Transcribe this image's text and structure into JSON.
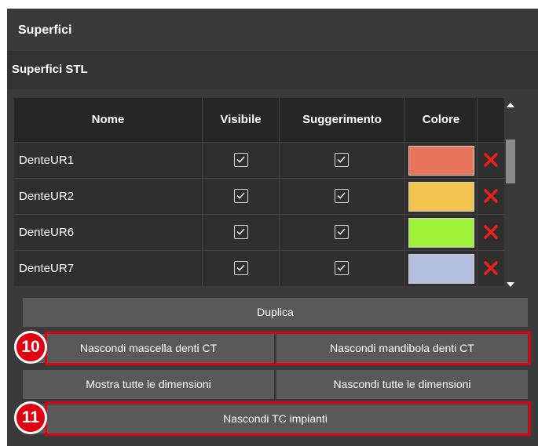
{
  "panel": {
    "title": "Superfici",
    "subtitle": "Superfici STL"
  },
  "table": {
    "headers": {
      "name": "Nome",
      "visible": "Visibile",
      "hint": "Suggerimento",
      "color": "Colore"
    },
    "rows": [
      {
        "name": "DenteUR1",
        "visible": true,
        "hint": true,
        "color": "#e8745a"
      },
      {
        "name": "DenteUR2",
        "visible": true,
        "hint": true,
        "color": "#f2c54f"
      },
      {
        "name": "DenteUR6",
        "visible": true,
        "hint": true,
        "color": "#9ef23a"
      },
      {
        "name": "DenteUR7",
        "visible": true,
        "hint": true,
        "color": "#b3bfdc"
      }
    ]
  },
  "buttons": {
    "duplicate": "Duplica",
    "hide_maxilla_teeth_ct": "Nascondi mascella denti CT",
    "hide_mandible_teeth_ct": "Nascondi mandibola denti CT",
    "show_all_dimensions": "Mostra tutte le dimensioni",
    "hide_all_dimensions": "Nascondi tutte le dimensioni",
    "hide_ct_implants": "Nascondi TC impianti"
  },
  "callouts": {
    "first": "10",
    "second": "11"
  },
  "colors": {
    "highlight": "#e0000f",
    "delete": "#e8211b"
  }
}
